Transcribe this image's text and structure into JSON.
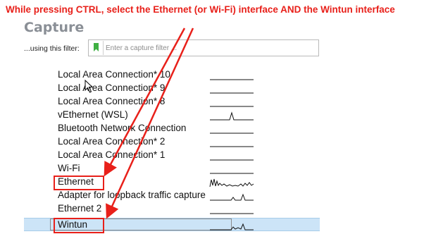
{
  "instruction": "While pressing CTRL, select the Ethernet (or Wi-Fi) interface AND the Wintun interface",
  "capture": {
    "title": "Capture",
    "filter_label": "...using this filter:",
    "filter_placeholder": "Enter a capture filter ..."
  },
  "interfaces": [
    {
      "name": "Local Area Connection* 10",
      "activity": "flat"
    },
    {
      "name": "Local Area Connection* 9",
      "activity": "flat"
    },
    {
      "name": "Local Area Connection* 8",
      "activity": "flat"
    },
    {
      "name": "vEthernet (WSL)",
      "activity": "single-spike"
    },
    {
      "name": "Bluetooth Network Connection",
      "activity": "flat"
    },
    {
      "name": "Local Area Connection* 2",
      "activity": "flat"
    },
    {
      "name": "Local Area Connection* 1",
      "activity": "flat"
    },
    {
      "name": "Wi-Fi",
      "activity": "flat"
    },
    {
      "name": "Ethernet",
      "activity": "busy",
      "highlighted": true
    },
    {
      "name": "Adapter for loopback traffic capture",
      "activity": "small-spikes"
    },
    {
      "name": "Ethernet 2",
      "activity": "flat"
    },
    {
      "name": "Wintun",
      "activity": "small-spikes",
      "selected": true,
      "highlighted": true
    }
  ],
  "colors": {
    "annotation": "#e8201a",
    "selection": "#cce4f7",
    "title": "#8a8f96",
    "bookmark": "#3fb043"
  }
}
